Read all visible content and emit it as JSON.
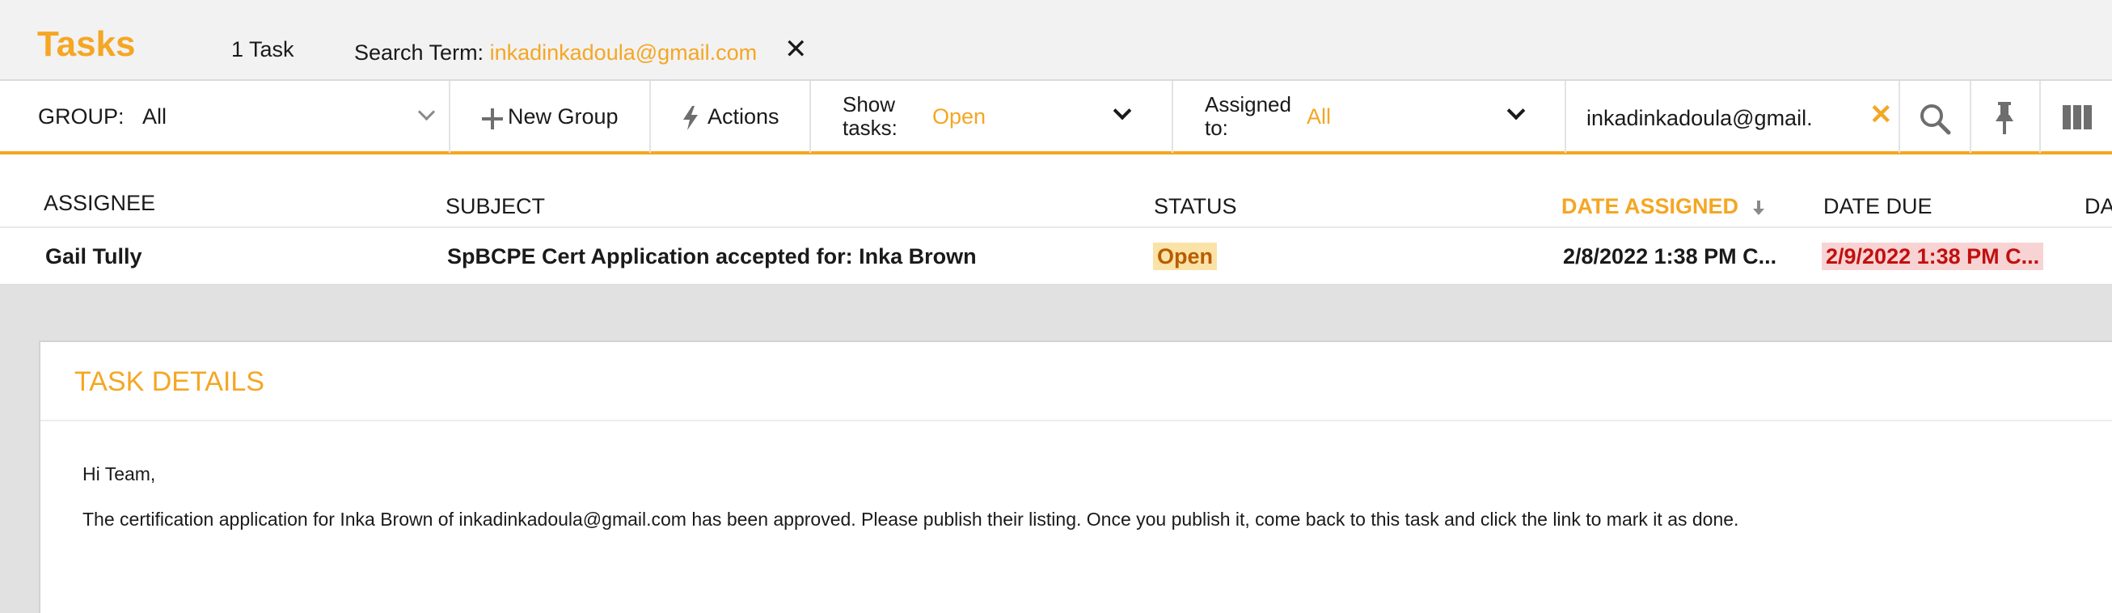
{
  "header": {
    "title": "Tasks",
    "task_count": "1 Task",
    "search_term_label": "Search Term: ",
    "search_term_value": "inkadinkadoula@gmail.com",
    "clear_icon": "close-icon"
  },
  "toolbar": {
    "group_label": "GROUP:",
    "group_value": "All",
    "new_group_label": "New Group",
    "actions_label": "Actions",
    "show_tasks_label_line1": "Show",
    "show_tasks_label_line2": "tasks:",
    "show_tasks_value": "Open",
    "assigned_label_line1": "Assigned",
    "assigned_label_line2": "to:",
    "assigned_value": "All",
    "search_value": "inkadinkadoula@gmail.",
    "icons": [
      "plus-icon",
      "bolt-icon",
      "search-icon",
      "pin-icon",
      "columns-icon"
    ]
  },
  "table": {
    "columns": [
      "ASSIGNEE",
      "SUBJECT",
      "STATUS",
      "DATE ASSIGNED",
      "DATE DUE",
      "DA"
    ],
    "sorted_column": "DATE ASSIGNED",
    "sort_direction": "descending",
    "rows": [
      {
        "assignee": "Gail Tully",
        "subject": "SpBCPE Cert Application accepted for: Inka Brown",
        "status": "Open",
        "date_assigned": "2/8/2022 1:38 PM C...",
        "date_due": "2/9/2022 1:38 PM C..."
      }
    ]
  },
  "details": {
    "title": "TASK DETAILS",
    "greeting": "Hi Team,",
    "body": "The certification application for Inka Brown of inkadinkadoula@gmail.com has been approved. Please publish their listing. Once you publish it, come back to this task and click the link to mark it as done."
  },
  "colors": {
    "accent": "#f5a623",
    "status_open_bg": "#fbe3a7",
    "overdue_bg": "#f8d3d3",
    "overdue_text": "#c20f0f"
  }
}
